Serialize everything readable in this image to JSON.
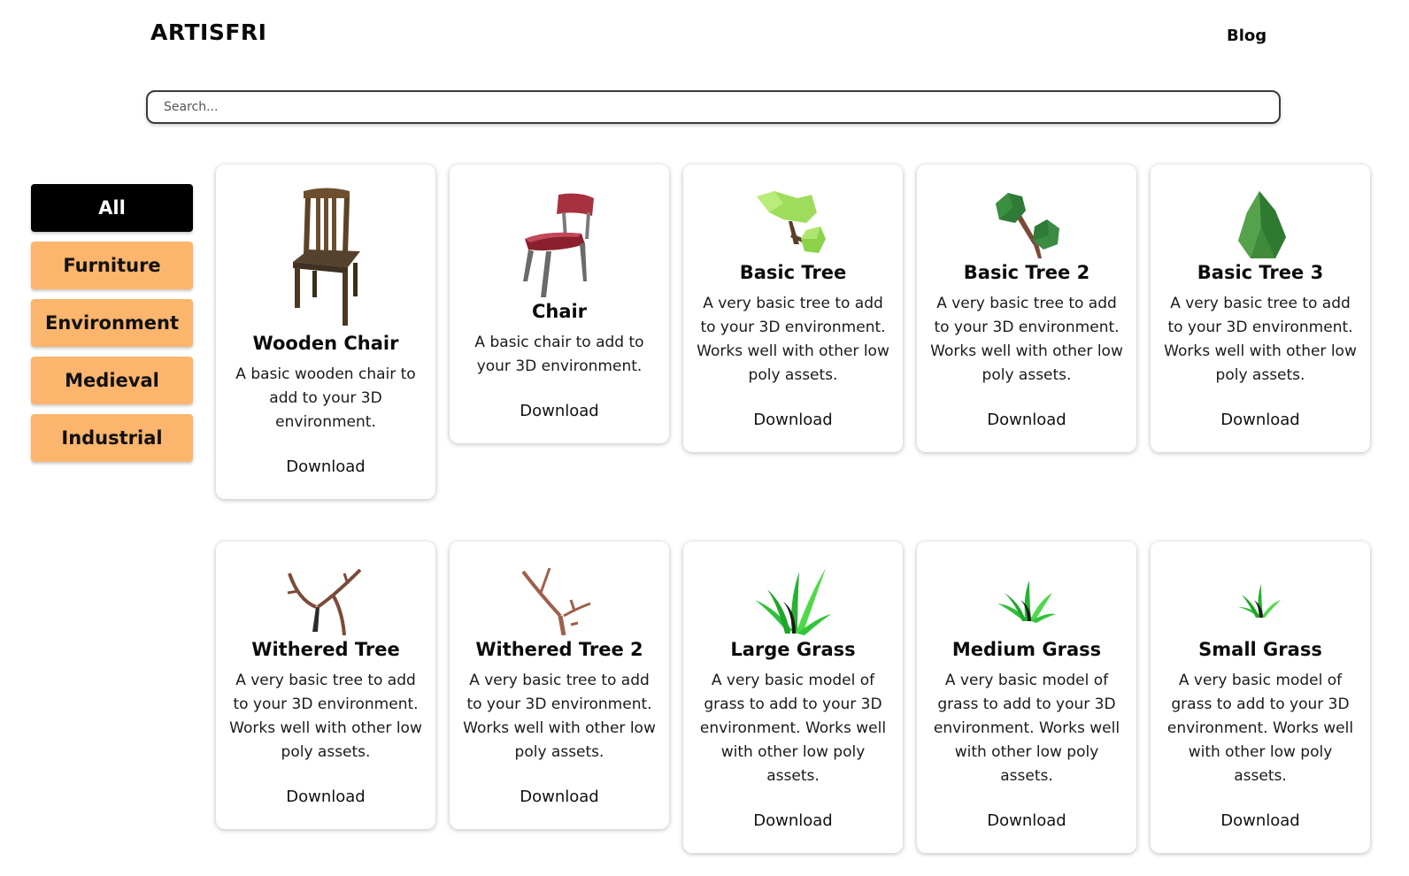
{
  "header": {
    "logo": "ARTISFRI",
    "nav_blog": "Blog"
  },
  "search": {
    "placeholder": "Search..."
  },
  "sidebar": {
    "categories": [
      {
        "label": "All",
        "active": true
      },
      {
        "label": "Furniture"
      },
      {
        "label": "Environment"
      },
      {
        "label": "Medieval"
      },
      {
        "label": "Industrial"
      }
    ]
  },
  "colors": {
    "category_button": "#fbb56d",
    "active_button": "#000000"
  },
  "assets": [
    {
      "icon": "wooden-chair-icon",
      "title": "Wooden Chair",
      "description": "A basic wooden chair to add to your 3D environment.",
      "download": "Download"
    },
    {
      "icon": "chair-icon",
      "title": "Chair",
      "description": "A basic chair to add to your 3D environment.",
      "download": "Download"
    },
    {
      "icon": "basic-tree-icon",
      "title": "Basic Tree",
      "description": "A very basic tree to add to your 3D environment. Works well with other low poly assets.",
      "download": "Download"
    },
    {
      "icon": "basic-tree-2-icon",
      "title": "Basic Tree 2",
      "description": "A very basic tree to add to your 3D environment. Works well with other low poly assets.",
      "download": "Download"
    },
    {
      "icon": "basic-tree-3-icon",
      "title": "Basic Tree 3",
      "description": "A very basic tree to add to your 3D environment. Works well with other low poly assets.",
      "download": "Download"
    },
    {
      "icon": "withered-tree-icon",
      "title": "Withered Tree",
      "description": "A very basic tree to add to your 3D environment. Works well with other low poly assets.",
      "download": "Download"
    },
    {
      "icon": "withered-tree-2-icon",
      "title": "Withered Tree 2",
      "description": "A very basic tree to add to your 3D environment. Works well with other low poly assets.",
      "download": "Download"
    },
    {
      "icon": "large-grass-icon",
      "title": "Large Grass",
      "description": "A very basic model of grass to add to your 3D environment. Works well with other low poly assets.",
      "download": "Download"
    },
    {
      "icon": "medium-grass-icon",
      "title": "Medium Grass",
      "description": "A very basic model of grass to add to your 3D environment. Works well with other low poly assets.",
      "download": "Download"
    },
    {
      "icon": "small-grass-icon",
      "title": "Small Grass",
      "description": "A very basic model of grass to add to your 3D environment. Works well with other low poly assets.",
      "download": "Download"
    }
  ]
}
